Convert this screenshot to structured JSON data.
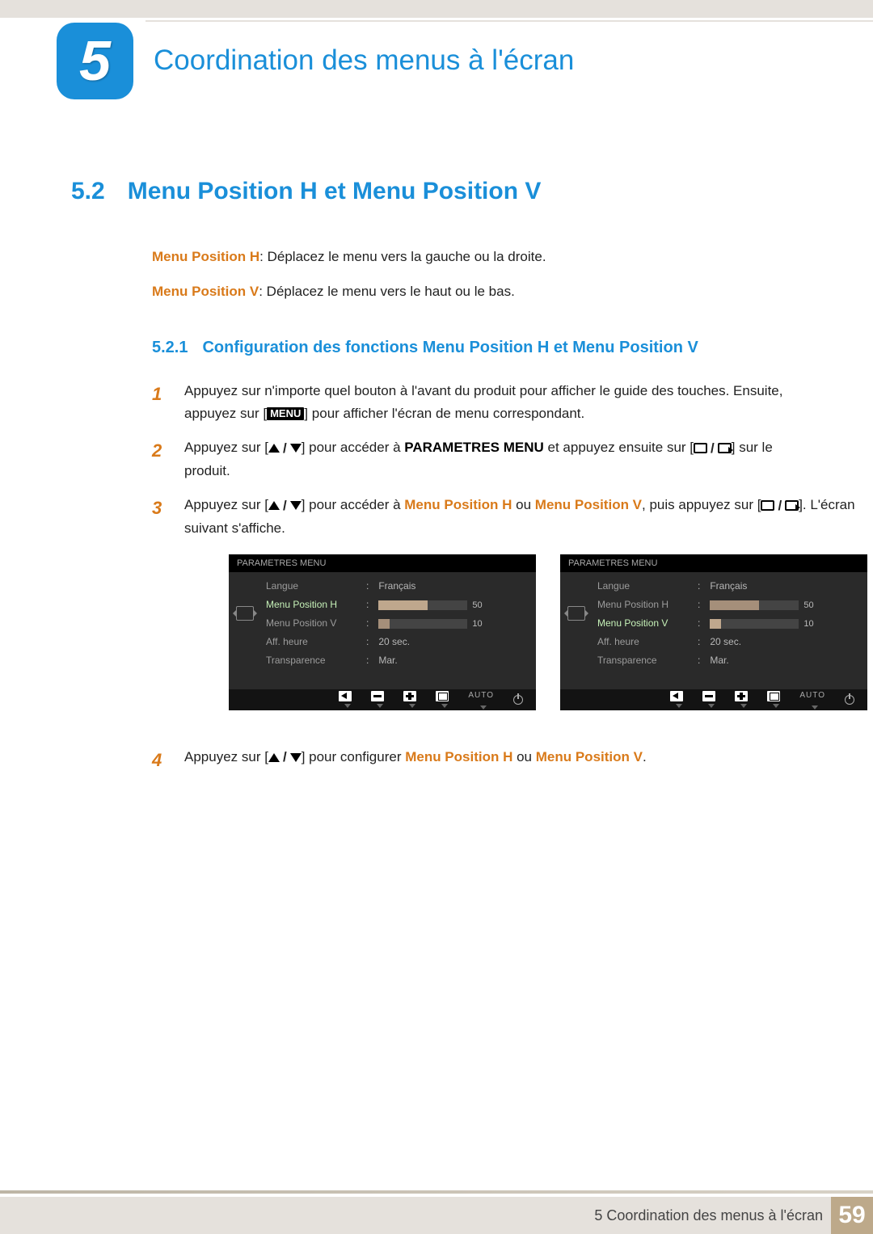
{
  "chapter": {
    "number": "5",
    "title": "Coordination des menus à l'écran"
  },
  "section": {
    "number": "5.2",
    "title": "Menu Position H et Menu Position V"
  },
  "definitions": {
    "h_label": "Menu Position H",
    "h_text": ": Déplacez le menu vers la gauche ou la droite.",
    "v_label": "Menu Position V",
    "v_text": ": Déplacez le menu vers le haut ou le bas."
  },
  "subsection": {
    "number": "5.2.1",
    "title": "Configuration des fonctions Menu Position H et Menu Position V"
  },
  "steps": {
    "s1a": "Appuyez sur n'importe quel bouton à l'avant du produit pour afficher le guide des touches. Ensuite, appuyez sur [",
    "s1menu": "MENU",
    "s1b": "] pour afficher l'écran de menu correspondant.",
    "s2a": "Appuyez sur [",
    "s2b": "] pour accéder à ",
    "s2param": "PARAMETRES MENU",
    "s2c": " et appuyez ensuite sur [",
    "s2d": "] sur le produit.",
    "s3a": "Appuyez sur [",
    "s3b": "] pour accéder à ",
    "s3h": "Menu Position H",
    "s3or": " ou ",
    "s3v": "Menu Position V",
    "s3c": ", puis appuyez sur [",
    "s3d": "]. L'écran suivant s'affiche.",
    "s4a": "Appuyez sur [",
    "s4b": "] pour configurer ",
    "s4h": "Menu Position H",
    "s4or": " ou ",
    "s4v": "Menu Position V",
    "s4end": "."
  },
  "osd": {
    "title": "PARAMETRES MENU",
    "langue_label": "Langue",
    "langue_val": "Français",
    "mph_label": "Menu Position H",
    "mph_val": "50",
    "mpv_label": "Menu Position V",
    "mpv_val": "10",
    "aff_label": "Aff. heure",
    "aff_val": "20 sec.",
    "trans_label": "Transparence",
    "trans_val": "Mar.",
    "auto": "AUTO"
  },
  "footer": {
    "text": "5 Coordination des menus à l'écran",
    "page": "59"
  }
}
